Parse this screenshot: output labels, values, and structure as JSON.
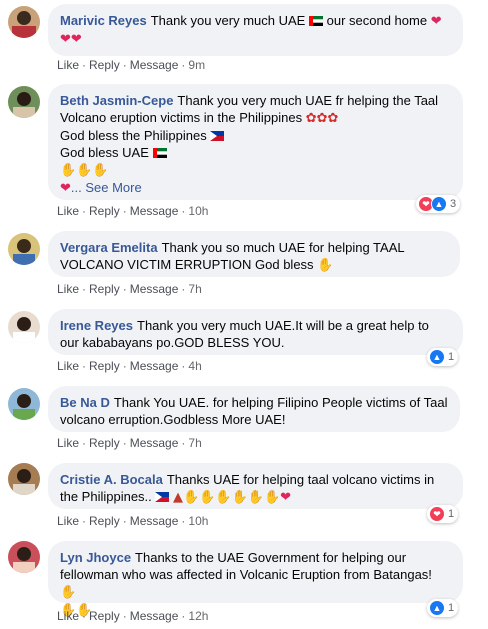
{
  "actions": {
    "like": "Like",
    "reply": "Reply",
    "message": "Message"
  },
  "comments": [
    {
      "author": "Marivic Reyes",
      "text": "Thank you very much UAE",
      "text2": "our second home",
      "time": "9m",
      "reactions": null
    },
    {
      "author": "Beth Jasmin-Cepe",
      "text": "Thank you very much UAE fr helping the Taal Volcano eruption victims in the Philippines",
      "line2": "God bless the Philippines",
      "line3": "God bless UAE",
      "see_more": "... See More",
      "time": "10h",
      "reactions": "3"
    },
    {
      "author": "Vergara Emelita",
      "text": "Thank you so much UAE for helping TAAL VOLCANO VICTIM ERRUPTION God bless",
      "time": "7h",
      "reactions": null
    },
    {
      "author": "Irene Reyes",
      "text": "Thank you very much UAE.It will be a great help to our kababayans po.GOD BLESS YOU.",
      "time": "4h",
      "reactions": "1"
    },
    {
      "author": "Be Na D",
      "text": "Thank You UAE. for helping Filipino People victims of Taal volcano erruption.Godbless More UAE!",
      "time": "7h",
      "reactions": null
    },
    {
      "author": "Cristie A. Bocala",
      "text": "Thanks UAE for helping taal volcano victims in the Philippines..",
      "time": "10h",
      "reactions": "1"
    },
    {
      "author": "Lyn Jhoyce",
      "text": "Thanks to the UAE Government for helping our fellowman who was affected in Volcanic Eruption from Batangas!",
      "time": "12h",
      "reactions": "1"
    }
  ],
  "colors": {
    "author": "#385898",
    "bubble": "#f0f2f5",
    "like": "#1877f2",
    "love": "#f33e58"
  }
}
